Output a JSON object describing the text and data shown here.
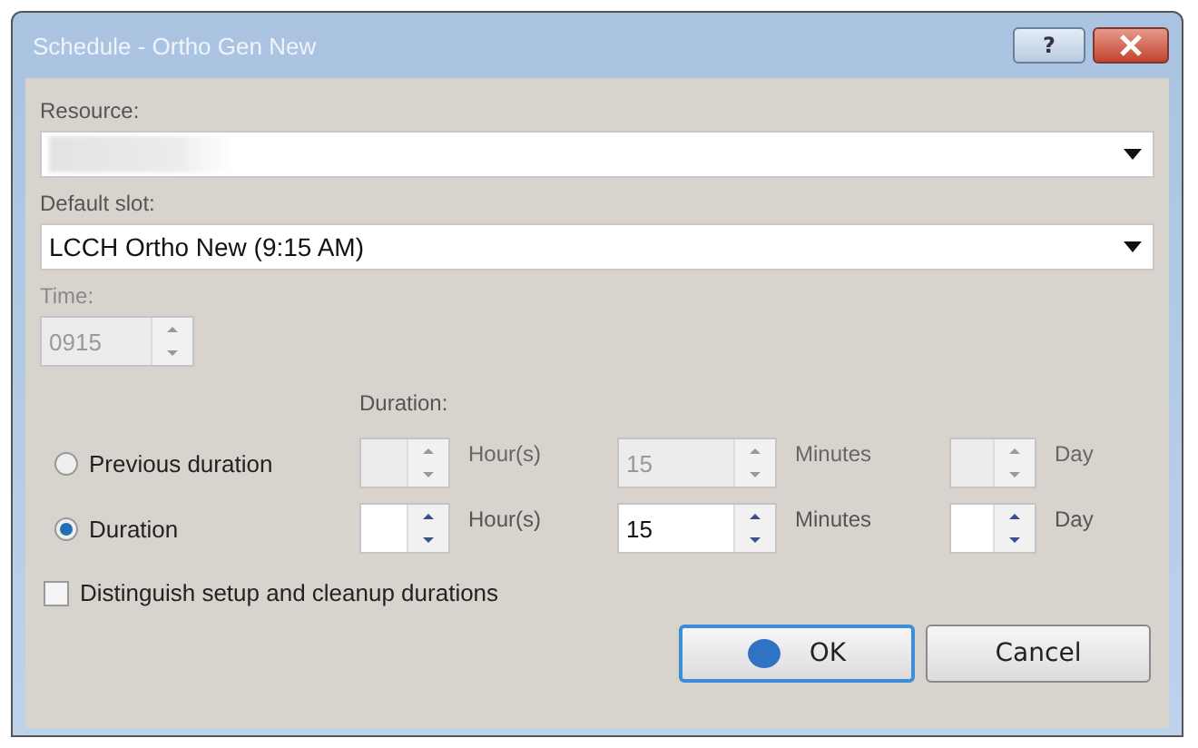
{
  "window": {
    "title": "Schedule - Ortho Gen New",
    "help_button": "?"
  },
  "resource": {
    "label": "Resource:"
  },
  "default_slot": {
    "label": "Default slot:",
    "value": "LCCH Ortho New (9:15 AM)"
  },
  "time": {
    "label": "Time:",
    "value": "0915",
    "disabled": true
  },
  "duration_header": "Duration:",
  "duration_options": [
    {
      "label": "Previous duration",
      "selected": false,
      "fields": [
        {
          "unit": "Hour(s)",
          "disabled": true
        },
        {
          "value": "15",
          "unit": "Minutes",
          "disabled": true
        },
        {
          "unit": "Day",
          "disabled": true
        }
      ]
    },
    {
      "label": "Duration",
      "selected": true,
      "fields": [
        {
          "unit": "Hour(s)",
          "disabled": false
        },
        {
          "value": "15",
          "unit": "Minutes",
          "disabled": false
        },
        {
          "unit": "Day",
          "disabled": false
        }
      ]
    }
  ],
  "distinguish": {
    "label": "Distinguish setup and cleanup durations",
    "checked": false
  },
  "buttons": [
    {
      "label": "OK",
      "default": true
    },
    {
      "label": "Cancel",
      "default": false
    }
  ]
}
